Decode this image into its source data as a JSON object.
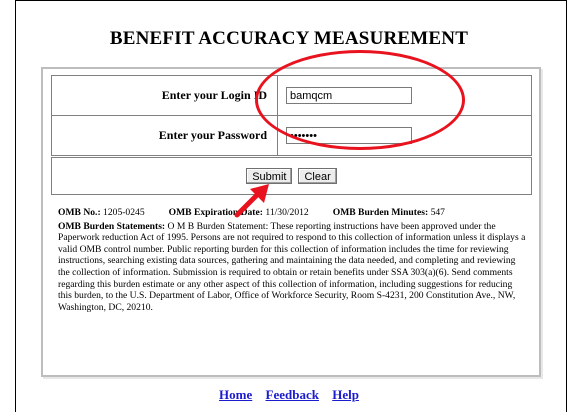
{
  "page": {
    "title": "BENEFIT ACCURACY MEASUREMENT"
  },
  "login_form": {
    "login_label": "Enter your Login ID",
    "login_value": "bamqcm",
    "password_label": "Enter your Password",
    "password_value": "•••••••",
    "submit_label": "Submit",
    "clear_label": "Clear"
  },
  "omb": {
    "number_label": "OMB No.:",
    "number_value": "1205-0245",
    "expiration_label": "OMB Expiration Date:",
    "expiration_value": "11/30/2012",
    "burden_minutes_label": "OMB Burden Minutes:",
    "burden_minutes_value": "547",
    "statements_label": "OMB Burden Statements:",
    "statements_text": "O M B Burden Statement: These reporting instructions have been approved under the Paperwork reduction Act of 1995. Persons are not required to respond to this collection of information unless it displays a valid OMB control number. Public reporting burden for this collection of information includes the time for reviewing instructions, searching existing data sources, gathering and maintaining the data needed, and completing and reviewing the collection of information. Submission is required to obtain or retain benefits under SSA 303(a)(6). Send comments regarding this burden estimate or any other aspect of this collection of information, including suggestions for reducing this burden, to the U.S. Department of Labor, Office of Workforce Security, Room S-4231, 200 Constitution Ave., NW, Washington, DC, 20210."
  },
  "footer": {
    "links": [
      "Home",
      "Feedback",
      "Help"
    ]
  },
  "annotations": {
    "highlight_color": "#e8131f"
  }
}
